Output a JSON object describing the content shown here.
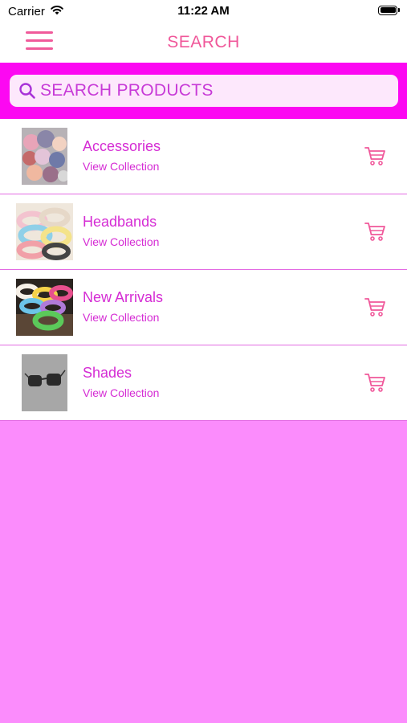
{
  "status_bar": {
    "carrier": "Carrier",
    "time": "11:22 AM"
  },
  "nav": {
    "title": "SEARCH"
  },
  "search": {
    "placeholder": "SEARCH PRODUCTS",
    "value": ""
  },
  "products": [
    {
      "title": "Accessories",
      "subtitle": "View Collection"
    },
    {
      "title": "Headbands",
      "subtitle": "View Collection"
    },
    {
      "title": "New Arrivals",
      "subtitle": "View Collection"
    },
    {
      "title": "Shades",
      "subtitle": "View Collection"
    }
  ],
  "colors": {
    "accent_pink": "#f0589a",
    "search_bar_bg": "#fc08f2",
    "item_text": "#d52cd4",
    "page_bg": "#fb8cfc"
  },
  "icons": {
    "menu": "hamburger-menu-icon",
    "search": "search-icon",
    "cart": "cart-icon",
    "wifi": "wifi-icon",
    "battery": "battery-icon"
  }
}
